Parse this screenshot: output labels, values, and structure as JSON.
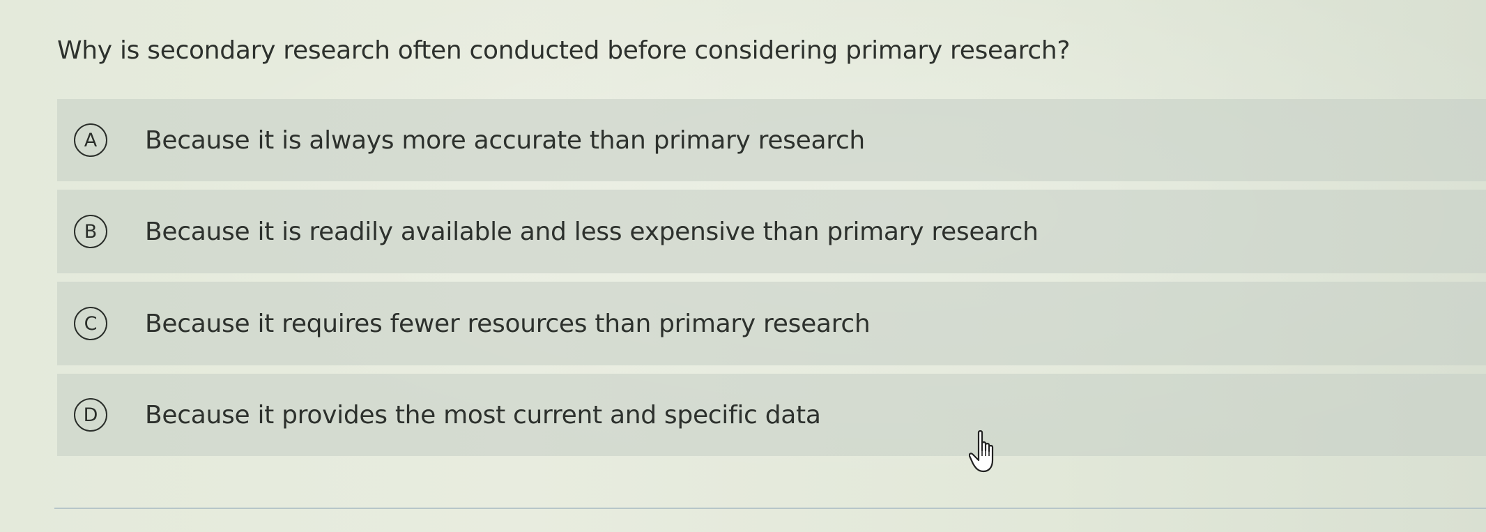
{
  "question": {
    "text": "Why is secondary research often conducted before considering primary research?"
  },
  "options": [
    {
      "letter": "A",
      "text": "Because it is always more accurate than primary research"
    },
    {
      "letter": "B",
      "text": "Because it is readily available and less expensive than primary research"
    },
    {
      "letter": "C",
      "text": "Because it requires fewer resources than primary research"
    },
    {
      "letter": "D",
      "text": "Because it provides the most current and specific data"
    }
  ],
  "cursor": {
    "icon": "hand-pointer-icon"
  }
}
